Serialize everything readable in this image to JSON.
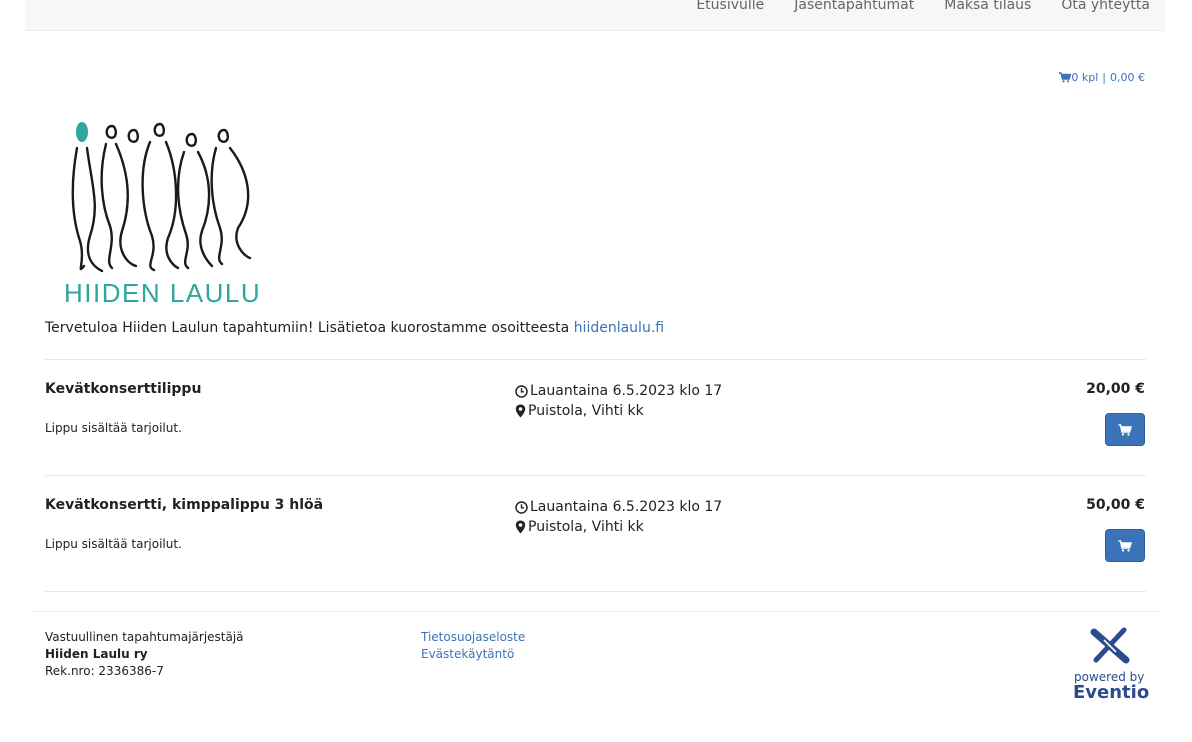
{
  "nav": {
    "items": [
      {
        "label": "Etusivulle"
      },
      {
        "label": "Jäsentapahtumat"
      },
      {
        "label": "Maksa tilaus"
      },
      {
        "label": "Ota yhteyttä"
      }
    ]
  },
  "cart": {
    "icon": "cart-icon",
    "count": "0 kpl",
    "separator": "|",
    "total": "0,00 €"
  },
  "logo": {
    "text": "HIIDEN LAULU",
    "colors": {
      "figures": "#1a1a1a",
      "accent": "#2ea6a0"
    }
  },
  "welcome": {
    "text": "Tervetuloa Hiiden Laulun tapahtumiin! Lisätietoa kuorostamme osoitteesta ",
    "link": "hiidenlaulu.fi"
  },
  "events": [
    {
      "title": "Kevätkonserttilippu",
      "description": "Lippu sisältää tarjoilut.",
      "datetime": "Lauantaina 6.5.2023 klo 17",
      "location": "Puistola, Vihti kk",
      "price": "20,00 €"
    },
    {
      "title": "Kevätkonsertti, kimppalippu 3 hlöä",
      "description": "Lippu sisältää tarjoilut.",
      "datetime": "Lauantaina 6.5.2023 klo 17",
      "location": "Puistola, Vihti kk",
      "price": "50,00 €"
    }
  ],
  "footer": {
    "responsible_label": "Vastuullinen tapahtumajärjestäjä",
    "org_name": "Hiiden Laulu ry",
    "reg_no": "Rek.nro: 2336386-7",
    "links": [
      {
        "label": "Tietosuojaseloste"
      },
      {
        "label": "Evästekäytäntö"
      }
    ],
    "powered_by": "powered by",
    "brand": "Eventio"
  },
  "colors": {
    "link": "#3b73b9",
    "button": "#3b73b9",
    "brand": "#2a4b8d"
  }
}
